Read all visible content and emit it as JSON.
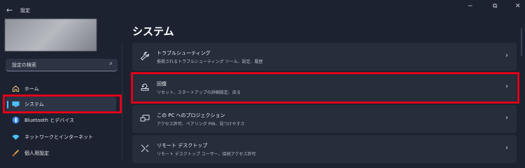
{
  "window": {
    "back_icon": "←",
    "title": "設定",
    "controls": [
      "−",
      "⧉",
      "✕"
    ]
  },
  "sidebar": {
    "search_placeholder": "設定の検索",
    "items": [
      {
        "label": "ホーム",
        "icon": "home-icon"
      },
      {
        "label": "システム",
        "icon": "display-icon",
        "active": true
      },
      {
        "label": "Bluetooth とデバイス",
        "icon": "bluetooth-icon"
      },
      {
        "label": "ネットワークとインターネット",
        "icon": "wifi-icon"
      },
      {
        "label": "個人用設定",
        "icon": "brush-icon"
      }
    ]
  },
  "main": {
    "title": "システム",
    "cards": [
      {
        "title": "トラブルシューティング",
        "subtitle": "推奨されるトラブルシューティング ツール、設定、履歴",
        "icon": "wrench-icon"
      },
      {
        "title": "回復",
        "subtitle": "リセット、スタートアップの詳細設定、戻る",
        "icon": "recovery-icon"
      },
      {
        "title": "この PC へのプロジェクション",
        "subtitle": "アクセス許可、ペアリング PIN、見つけやすさ",
        "icon": "projection-icon"
      },
      {
        "title": "リモート デスクトップ",
        "subtitle": "リモート デスクトップ ユーザー、接続アクセス許可",
        "icon": "remote-desktop-icon"
      }
    ],
    "chevron": "›"
  },
  "colors": {
    "accent": "#4cc2ff",
    "highlight": "#e0001a",
    "background": "#1c2230",
    "card": "#262d3b"
  }
}
